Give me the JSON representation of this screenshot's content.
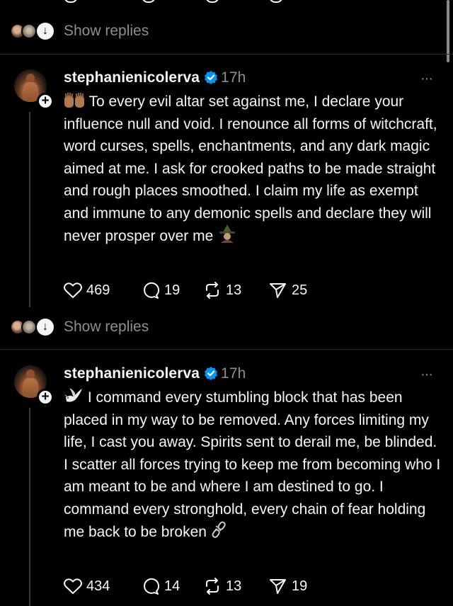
{
  "show_replies": [
    "Show replies",
    "Show replies"
  ],
  "posts": [
    {
      "username": "stephanienicolerva",
      "time": "17h",
      "more": "···",
      "body": "To every evil altar set against me, I declare your influence null and void. I renounce all forms of witchcraft, word curses, spells, enchantments, and any dark magic aimed at me. I ask for crooked paths to be made straight and rough places smoothed. I claim my life as exempt and immune to any demonic spells and declare they will never prosper over me",
      "lead_icon": "praying-hands-icon",
      "trail_icon": "witch-icon",
      "likes": "469",
      "replies": "19",
      "reposts": "13",
      "shares": "25"
    },
    {
      "username": "stephanienicolerva",
      "time": "17h",
      "more": "···",
      "body": "I command every stumbling block that has been placed in my way to be removed. Any forces limiting my life, I cast you away. Spirits sent to derail me, be blinded. I scatter all forces trying to keep me from becoming who I am meant to be and where I am destined to go. I command every stronghold, every chain of fear holding me back to be broken",
      "lead_icon": "dove-icon",
      "trail_icon": "broken-chain-icon",
      "likes": "434",
      "replies": "14",
      "reposts": "13",
      "shares": "19"
    }
  ],
  "colors": {
    "background": "#000000",
    "text": "#f3f5f7",
    "muted": "#8e8e8e",
    "verified": "#0095f6"
  }
}
